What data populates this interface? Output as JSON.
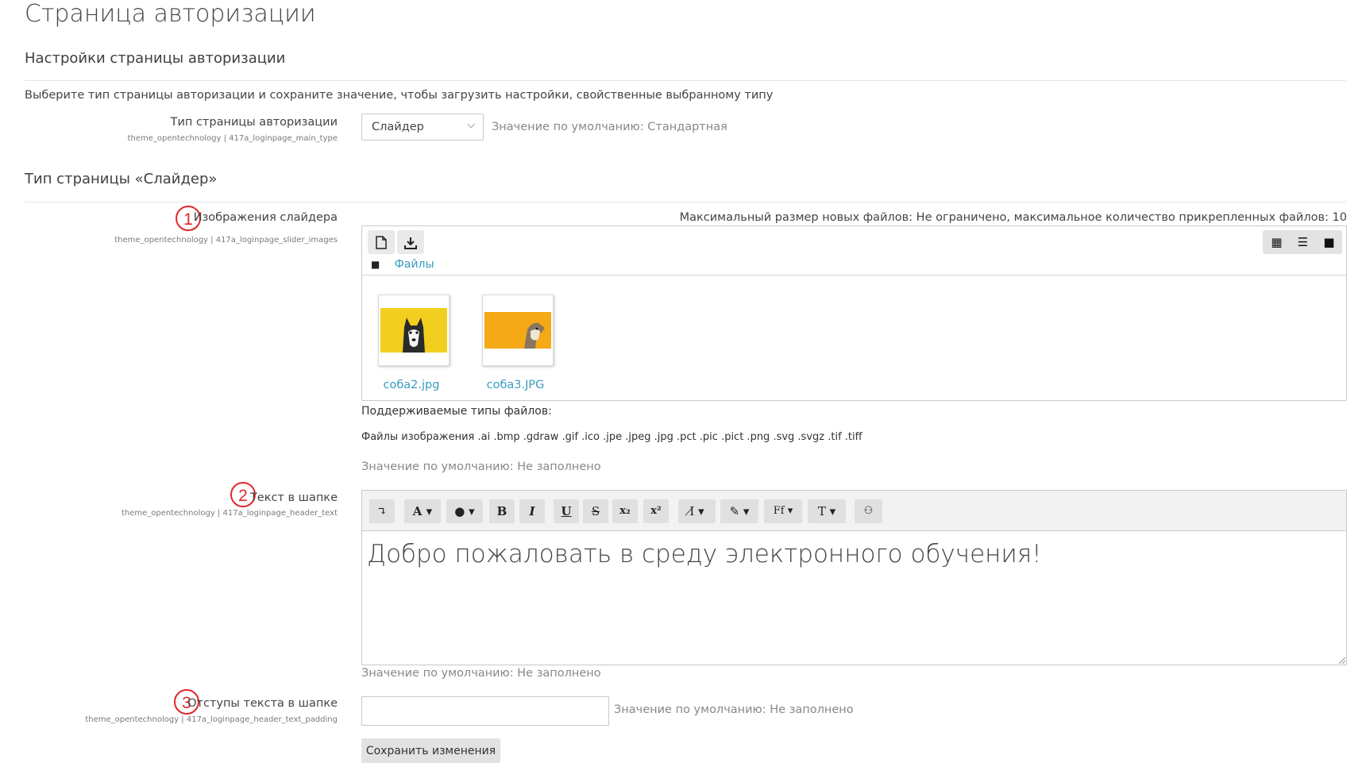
{
  "page_title": "Страница авторизации",
  "section1": {
    "title": "Настройки страницы авторизации",
    "intro": "Выберите тип страницы авторизации и сохраните значение, чтобы загрузить настройки, свойственные выбранному типу",
    "type_field": {
      "label": "Тип страницы авторизации",
      "sublabel": "theme_opentechnology | 417a_loginpage_main_type",
      "selected": "Слайдер",
      "default": "Значение по умолчанию: Стандартная"
    }
  },
  "section2": {
    "title": "Тип страницы «Слайдер»",
    "slider_images": {
      "marker": "1",
      "label": "Изображения слайдера",
      "sublabel": "theme_opentechnology | 417a_loginpage_slider_images",
      "limits": "Максимальный размер новых файлов: Не ограничено, максимальное количество прикрепленных файлов: 10",
      "path_link": "Файлы",
      "files": [
        {
          "name": "coбa2.jpg",
          "bg": "#f2cf1f",
          "icon": "husky-dog-thumbnail"
        },
        {
          "name": "coбa3.JPG",
          "bg": "#f5a916",
          "icon": "dog-thumbnail"
        }
      ],
      "supported_title": "Поддерживаемые типы файлов:",
      "supported_list": "Файлы изображения .ai .bmp .gdraw .gif .ico .jpe .jpeg .jpg .pct .pic .pict .png .svg .svgz .tif .tiff",
      "default": "Значение по умолчанию: Не заполнено"
    },
    "header_text": {
      "marker": "2",
      "label": "Текст в шапке",
      "sublabel": "theme_opentechnology | 417a_loginpage_header_text",
      "content": "Добро пожаловать в среду электронного обучения!",
      "default": "Значение по умолчанию: Не заполнено"
    },
    "header_padding": {
      "marker": "3",
      "label": "Отступы текста в шапке",
      "sublabel": "theme_opentechnology | 417a_loginpage_header_text_padding",
      "value": "",
      "default": "Значение по умолчанию: Не заполнено"
    },
    "save_label": "Сохранить изменения"
  },
  "colors": {
    "link": "#3a9cc0",
    "marker_red": "#e0262b"
  }
}
